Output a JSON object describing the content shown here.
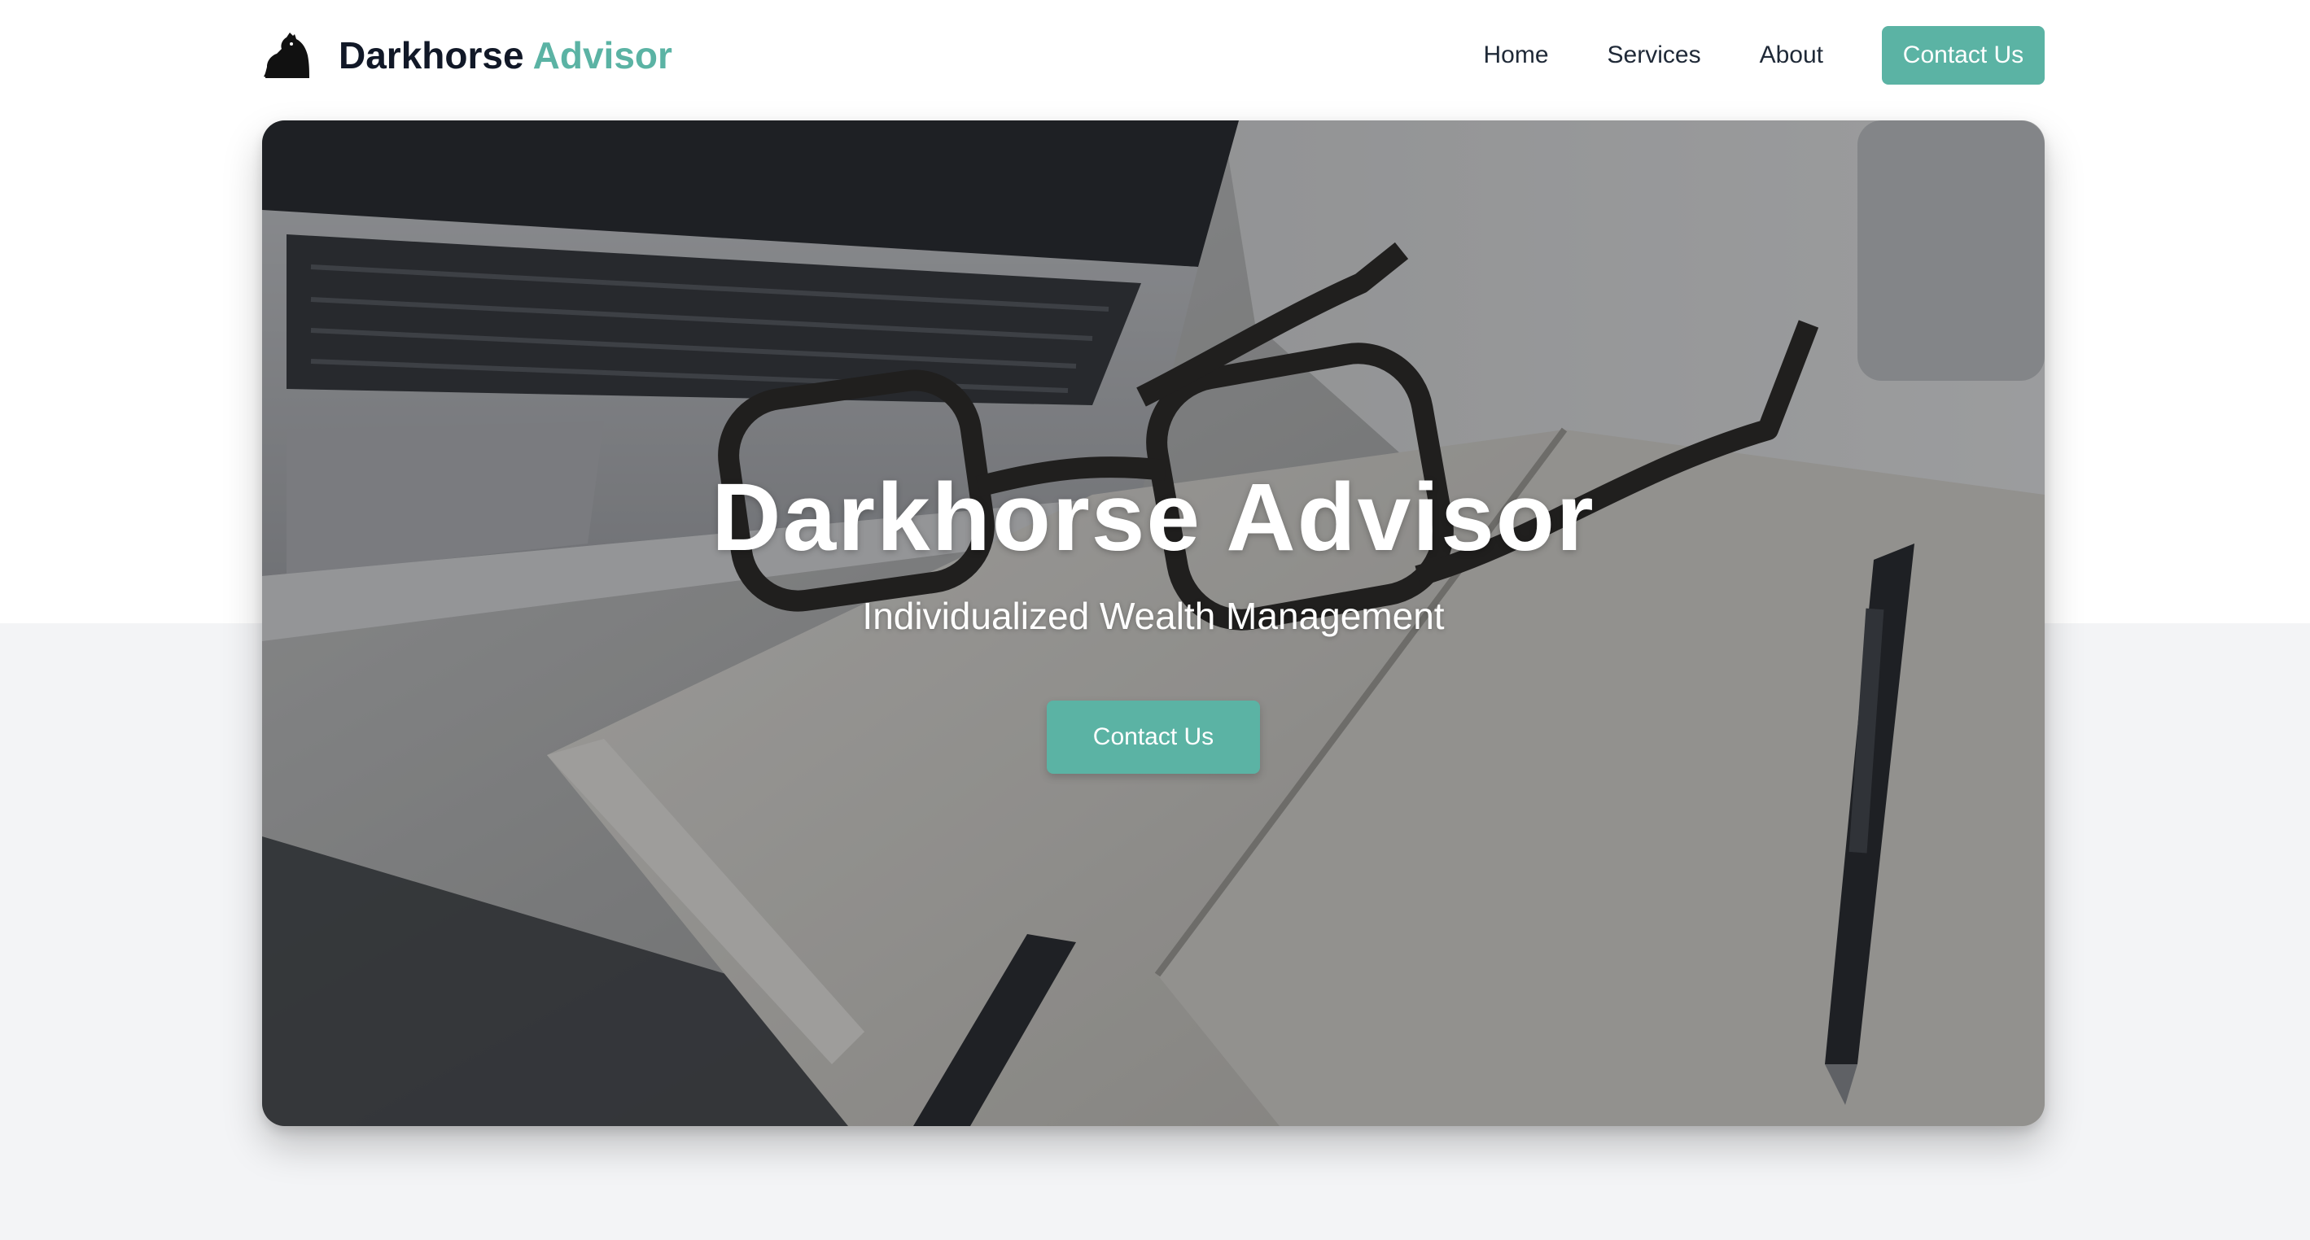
{
  "header": {
    "brand_primary": "Darkhorse",
    "brand_accent": "Advisor",
    "logo_icon": "horse-head-icon",
    "nav": [
      {
        "label": "Home"
      },
      {
        "label": "Services"
      },
      {
        "label": "About"
      }
    ],
    "cta_label": "Contact Us"
  },
  "hero": {
    "title": "Darkhorse Advisor",
    "subtitle": "Individualized Wealth Management",
    "cta_label": "Contact Us",
    "background_image": "laptop-glasses-notebook-pen-photo"
  },
  "colors": {
    "accent": "#5bb3a4",
    "text_dark": "#111827",
    "lower_background": "#f3f4f6"
  }
}
